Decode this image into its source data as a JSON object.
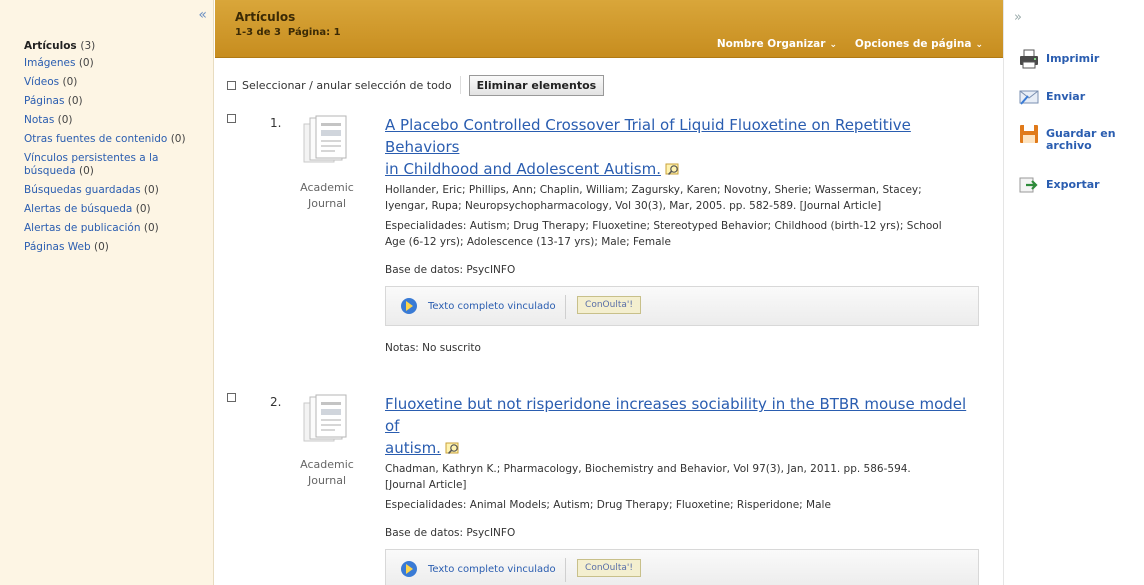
{
  "sidebar": {
    "collapse_glyph": "«",
    "items": [
      {
        "label": "Artículos",
        "count": "(3)"
      },
      {
        "label": "Imágenes",
        "count": "(0)"
      },
      {
        "label": "Vídeos",
        "count": "(0)"
      },
      {
        "label": "Páginas",
        "count": "(0)"
      },
      {
        "label": "Notas",
        "count": "(0)"
      },
      {
        "label": "Otras fuentes de contenido",
        "count": "(0)"
      },
      {
        "label": "Vínculos persistentes a la búsqueda",
        "count": "(0)"
      },
      {
        "label": "Búsquedas guardadas",
        "count": "(0)"
      },
      {
        "label": "Alertas de búsqueda",
        "count": "(0)"
      },
      {
        "label": "Alertas de publicación",
        "count": "(0)"
      },
      {
        "label": "Páginas Web",
        "count": "(0)"
      }
    ]
  },
  "header": {
    "title": "Artículos",
    "range": "1-3 de 3",
    "page_label": "Página: 1",
    "sort_label": "Nombre Organizar",
    "options_label": "Opciones de página",
    "chevron": "⌄"
  },
  "toolbar": {
    "select_all_label": "Seleccionar / anular selección de todo",
    "delete_label": "Eliminar elementos"
  },
  "results": [
    {
      "number": "1.",
      "type_line1": "Academic",
      "type_line2": "Journal",
      "title_line1": "A Placebo Controlled Crossover Trial of Liquid Fluoxetine on Repetitive Behaviors",
      "title_line2": "in Childhood and Adolescent Autism.",
      "meta_line1": "Hollander, Eric; Phillips, Ann; Chaplin, William; Zagursky, Karen; Novotny, Sherie; Wasserman, Stacey;",
      "meta_line2": "Iyengar, Rupa; Neuropsychopharmacology, Vol 30(3), Mar, 2005. pp. 582-589. [Journal Article]",
      "subjects_line1": "Especialidades: Autism; Drug Therapy; Fluoxetine; Stereotyped Behavior; Childhood (birth-12 yrs); School",
      "subjects_line2": "Age (6-12 yrs); Adolescence (13-17 yrs); Male; Female",
      "database": "Base de datos: PsycINFO",
      "fulltext_label": "Texto completo vinculado",
      "consulta_label": "ConOulta'!",
      "notes": "Notas:  No suscrito"
    },
    {
      "number": "2.",
      "type_line1": "Academic",
      "type_line2": "Journal",
      "title_line1": "Fluoxetine but not risperidone increases sociability in the BTBR mouse model of",
      "title_line2": "autism.",
      "meta_line1": "Chadman, Kathryn K.; Pharmacology, Biochemistry and Behavior, Vol 97(3), Jan, 2011. pp. 586-594.",
      "meta_line2": "[Journal Article]",
      "subjects_line1": "Especialidades: Animal Models; Autism; Drug Therapy; Fluoxetine; Risperidone; Male",
      "database": "Base de datos: PsycINFO",
      "fulltext_label": "Texto completo vinculado",
      "consulta_label": "ConOulta'!"
    }
  ],
  "tools": {
    "collapse_glyph": "»",
    "print_label": "Imprimir",
    "send_label": "Enviar",
    "save_line1": "Guardar en",
    "save_line2": "archivo",
    "export_label": "Exportar"
  }
}
